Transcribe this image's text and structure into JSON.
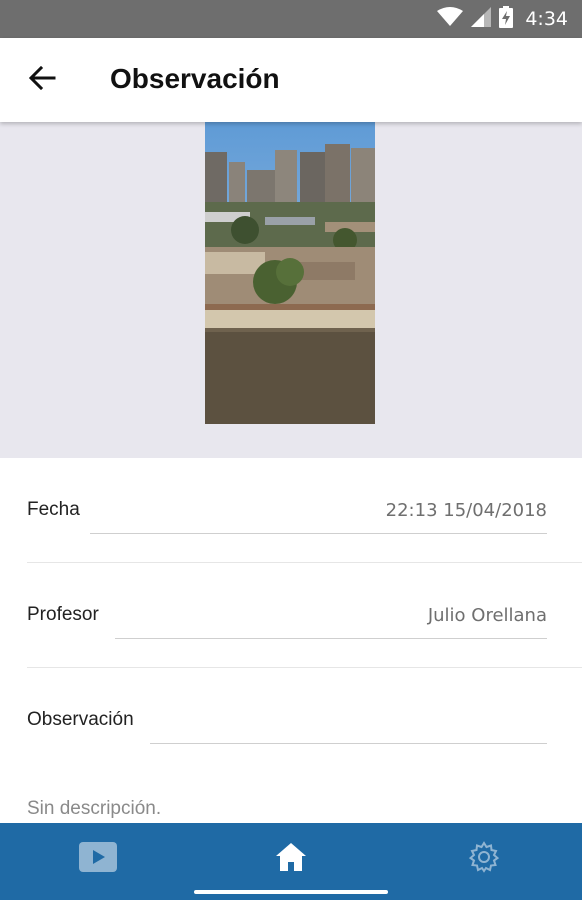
{
  "status_bar": {
    "time": "4:34",
    "icons": [
      "wifi-icon",
      "cellular-icon",
      "battery-charging-icon"
    ]
  },
  "app_bar": {
    "back_icon": "arrow-left-icon",
    "title": "Observación"
  },
  "photo": {
    "description_icon": "photo-city-view"
  },
  "fields": {
    "fecha": {
      "label": "Fecha",
      "value": "22:13 15/04/2018"
    },
    "profesor": {
      "label": "Profesor",
      "value": "Julio Orellana"
    },
    "observacion": {
      "label": "Observación",
      "value": ""
    }
  },
  "description": "Sin descripción.",
  "bottom_nav": {
    "items": [
      {
        "icon": "video-icon",
        "active": false
      },
      {
        "icon": "home-icon",
        "active": true
      },
      {
        "icon": "settings-gear-icon",
        "active": false
      }
    ]
  },
  "colors": {
    "status_bar": "#6e6e6e",
    "photo_background": "#e8e7ee",
    "bottom_nav": "#1f6aa5"
  }
}
